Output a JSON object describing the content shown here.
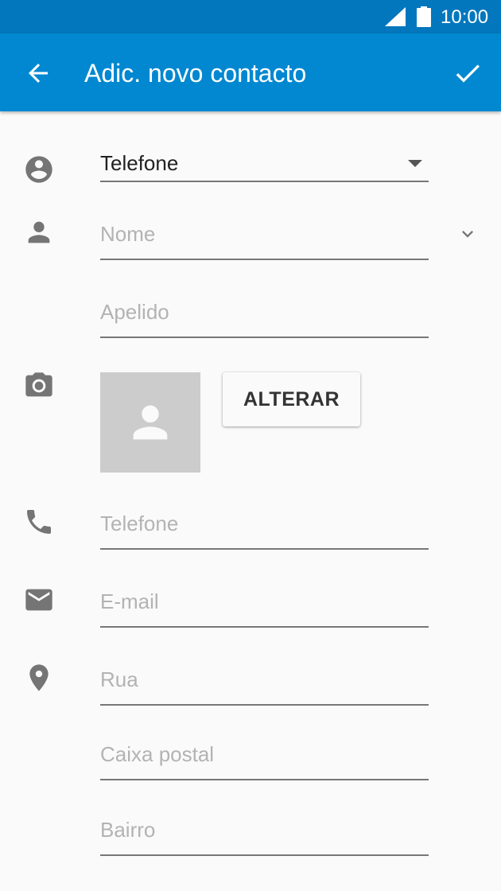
{
  "status_bar": {
    "time": "10:00"
  },
  "app_bar": {
    "title": "Adic. novo contacto"
  },
  "form": {
    "account": {
      "value": "Telefone"
    },
    "first_name": {
      "placeholder": "Nome"
    },
    "last_name": {
      "placeholder": "Apelido"
    },
    "photo": {
      "change_label": "ALTERAR"
    },
    "phone": {
      "placeholder": "Telefone"
    },
    "email": {
      "placeholder": "E-mail"
    },
    "street": {
      "placeholder": "Rua"
    },
    "po_box": {
      "placeholder": "Caixa postal"
    },
    "neighborhood": {
      "placeholder": "Bairro"
    }
  },
  "colors": {
    "status_bar": "#0277bd",
    "app_bar": "#0288d1",
    "background": "#fafafa",
    "icon_gray": "#757575",
    "placeholder": "#b3b3b3"
  },
  "icons": [
    "back-arrow-icon",
    "checkmark-icon",
    "signal-icon",
    "battery-icon",
    "account-icon",
    "person-icon",
    "chevron-down-icon",
    "camera-icon",
    "phone-icon",
    "email-icon",
    "location-pin-icon"
  ]
}
